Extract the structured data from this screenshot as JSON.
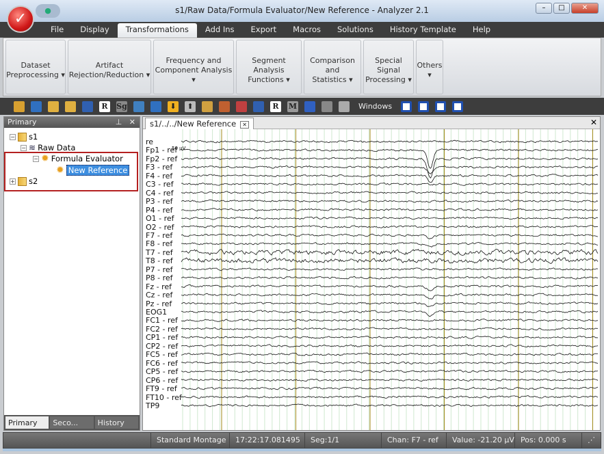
{
  "window": {
    "title": "s1/Raw Data/Formula Evaluator/New Reference - Analyzer 2.1",
    "min": "–",
    "max": "□",
    "close": "✕"
  },
  "menu": [
    "File",
    "Display",
    "Transformations",
    "Add Ins",
    "Export",
    "Macros",
    "Solutions",
    "History Template",
    "Help"
  ],
  "menu_active": "Transformations",
  "ribbon": [
    {
      "l1": "Dataset",
      "l2": "Preprocessing ▾"
    },
    {
      "l1": "Artifact",
      "l2": "Rejection/Reduction ▾"
    },
    {
      "l1": "Frequency and",
      "l2": "Component Analysis ▾"
    },
    {
      "l1": "Segment Analysis",
      "l2": "Functions ▾"
    },
    {
      "l1": "Comparison and",
      "l2": "Statistics ▾"
    },
    {
      "l1": "Special Signal",
      "l2": "Processing ▾"
    },
    {
      "l1": "Others",
      "l2": "▾"
    }
  ],
  "toolbar": {
    "windows_label": "Windows",
    "icons": [
      "open-icon",
      "chart-icon",
      "zoom-in-icon",
      "zoom-out-icon",
      "grid-icon",
      "r-icon",
      "sg-icon",
      "wave-icon",
      "stack-icon",
      "down-arrow-icon",
      "up-arrow-icon",
      "peak-icon",
      "marker-icon",
      "baseline-icon",
      "scale-icon",
      "r2-icon",
      "m-icon",
      "book-icon",
      "plus-icon",
      "tile-icon"
    ]
  },
  "left_panel": {
    "title": "Primary",
    "pin": "ᵖ",
    "close": "✕",
    "tree": {
      "s1": "s1",
      "raw": "Raw Data",
      "formula": "Formula Evaluator",
      "newref": "New Reference",
      "s2": "s2"
    },
    "tabs": [
      "Primary",
      "Seco...",
      "History"
    ]
  },
  "view": {
    "tab": "s1/../../New Reference",
    "tab_close": "✕",
    "panel_close": "✕",
    "scale_label": "50 µV",
    "channels": [
      "re",
      "Fp1 - ref",
      "Fp2 - ref",
      "F3 - ref",
      "F4 - ref",
      "C3 - ref",
      "C4 - ref",
      "P3 - ref",
      "P4 - ref",
      "O1 - ref",
      "O2 - ref",
      "F7 - ref",
      "F8 - ref",
      "T7 - ref",
      "T8 - ref",
      "P7 - ref",
      "P8 - ref",
      "Fz - ref",
      "Cz - ref",
      "Pz - ref",
      "EOG1",
      "FC1 - ref",
      "FC2 - ref",
      "CP1 - ref",
      "CP2 - ref",
      "FC5 - ref",
      "FC6 - ref",
      "CP5 - ref",
      "CP6 - ref",
      "FT9 - ref",
      "FT10 - ref",
      "TP9"
    ],
    "colors": {
      "trace": "#111111",
      "major_grid": "#a08a1a",
      "minor_grid": "#cfe8cf"
    }
  },
  "status": {
    "montage": "Standard Montage",
    "time": "17:22:17.081495",
    "seg": "Seg:1/1",
    "chan": "Chan:  F7 - ref",
    "value": "Value: -21.20 µV",
    "pos": "Pos:  0.000 s"
  }
}
